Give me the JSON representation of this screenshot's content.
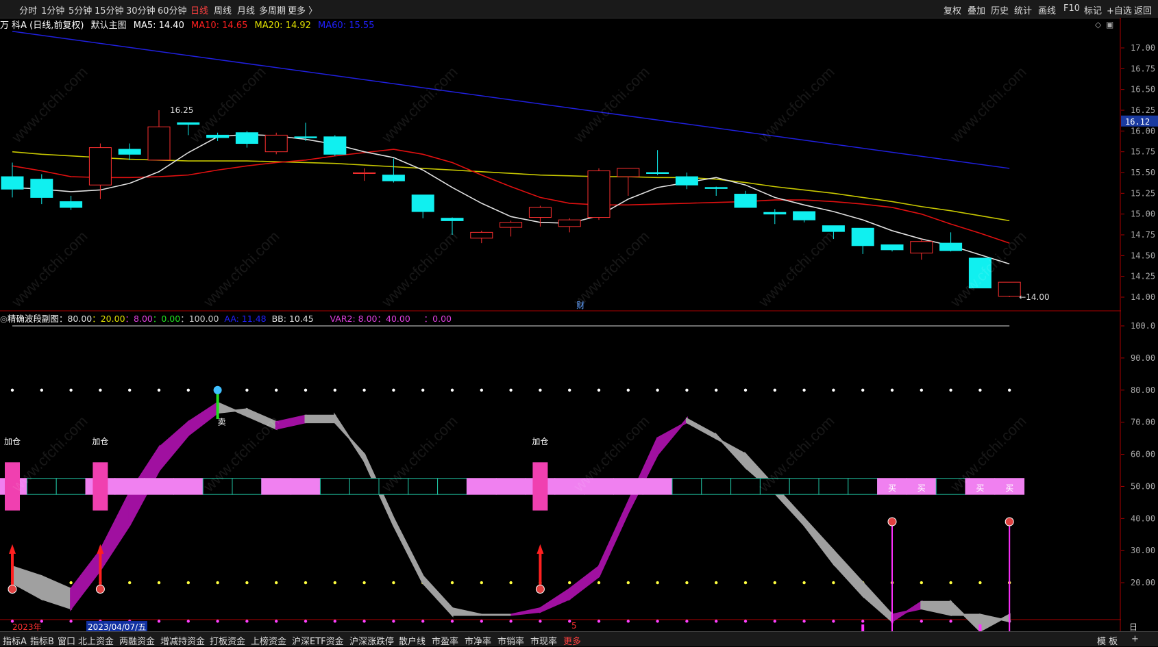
{
  "toolbar": {
    "left_items": [
      "分时",
      "1分钟",
      "5分钟",
      "15分钟",
      "30分钟",
      "60分钟",
      "日线",
      "周线",
      "月线",
      "多周期",
      "更多 〉"
    ],
    "active": "日线",
    "right_items": [
      "复权",
      "叠加",
      "历史",
      "统计",
      "画线",
      "F10",
      "标记",
      "+自选",
      "返回"
    ]
  },
  "main_chart": {
    "stock_name": "万 科A (日线,前复权)",
    "template_label": "默认主图",
    "ma5": "MA5: 14.40",
    "ma10": "MA10: 14.65",
    "ma20": "MA20: 14.92",
    "ma60": "MA60: 15.55",
    "ma_colors": {
      "ma5": "#ffffff",
      "ma10": "#ff2020",
      "ma20": "#e0e000",
      "ma60": "#2020ff"
    },
    "price_ticks": [
      "17.00",
      "16.75",
      "16.50",
      "16.25",
      "16.00",
      "15.75",
      "15.50",
      "15.25",
      "15.00",
      "14.75",
      "14.50",
      "14.25",
      "14.00"
    ],
    "current_price_tag": "16.12",
    "high_label": "16.25",
    "low_label": "←14.00",
    "finance_marker": "财",
    "candles": [
      {
        "o": 15.45,
        "c": 15.3,
        "h": 15.62,
        "l": 15.2
      },
      {
        "o": 15.42,
        "c": 15.2,
        "h": 15.48,
        "l": 15.12
      },
      {
        "o": 15.15,
        "c": 15.08,
        "h": 15.22,
        "l": 15.05
      },
      {
        "o": 15.35,
        "c": 15.8,
        "h": 15.85,
        "l": 15.18
      },
      {
        "o": 15.78,
        "c": 15.72,
        "h": 15.85,
        "l": 15.65
      },
      {
        "o": 15.65,
        "c": 16.05,
        "h": 16.25,
        "l": 15.65
      },
      {
        "o": 16.1,
        "c": 16.08,
        "h": 16.1,
        "l": 15.95
      },
      {
        "o": 15.95,
        "c": 15.92,
        "h": 15.98,
        "l": 15.88
      },
      {
        "o": 15.98,
        "c": 15.85,
        "h": 16.0,
        "l": 15.8
      },
      {
        "o": 15.75,
        "c": 15.95,
        "h": 15.98,
        "l": 15.72
      },
      {
        "o": 15.93,
        "c": 15.92,
        "h": 16.1,
        "l": 15.88
      },
      {
        "o": 15.93,
        "c": 15.72,
        "h": 15.95,
        "l": 15.7
      },
      {
        "o": 15.5,
        "c": 15.5,
        "h": 15.55,
        "l": 15.4
      },
      {
        "o": 15.47,
        "c": 15.4,
        "h": 15.67,
        "l": 15.38
      },
      {
        "o": 15.23,
        "c": 15.03,
        "h": 15.23,
        "l": 14.95
      },
      {
        "o": 14.95,
        "c": 14.92,
        "h": 14.96,
        "l": 14.75
      },
      {
        "o": 14.71,
        "c": 14.78,
        "h": 14.8,
        "l": 14.65
      },
      {
        "o": 14.84,
        "c": 14.9,
        "h": 14.92,
        "l": 14.73
      },
      {
        "o": 14.96,
        "c": 15.08,
        "h": 15.1,
        "l": 14.85
      },
      {
        "o": 14.85,
        "c": 14.93,
        "h": 14.95,
        "l": 14.78
      },
      {
        "o": 14.96,
        "c": 15.52,
        "h": 15.55,
        "l": 14.93
      },
      {
        "o": 15.45,
        "c": 15.55,
        "h": 15.55,
        "l": 15.22
      },
      {
        "o": 15.5,
        "c": 15.49,
        "h": 15.77,
        "l": 15.47
      },
      {
        "o": 15.45,
        "c": 15.35,
        "h": 15.5,
        "l": 15.3
      },
      {
        "o": 15.32,
        "c": 15.31,
        "h": 15.33,
        "l": 15.22
      },
      {
        "o": 15.24,
        "c": 15.08,
        "h": 15.28,
        "l": 15.08
      },
      {
        "o": 15.02,
        "c": 15.0,
        "h": 15.06,
        "l": 14.88
      },
      {
        "o": 15.03,
        "c": 14.93,
        "h": 15.03,
        "l": 14.9
      },
      {
        "o": 14.86,
        "c": 14.79,
        "h": 14.86,
        "l": 14.7
      },
      {
        "o": 14.83,
        "c": 14.62,
        "h": 14.83,
        "l": 14.52
      },
      {
        "o": 14.63,
        "c": 14.57,
        "h": 14.63,
        "l": 14.55
      },
      {
        "o": 14.53,
        "c": 14.67,
        "h": 14.7,
        "l": 14.45
      },
      {
        "o": 14.65,
        "c": 14.56,
        "h": 14.78,
        "l": 14.55
      },
      {
        "o": 14.47,
        "c": 14.11,
        "h": 14.47,
        "l": 14.11
      },
      {
        "o": 14.01,
        "c": 14.18,
        "h": 14.18,
        "l": 14.0
      }
    ],
    "ma5_series": [
      15.32,
      15.3,
      15.27,
      15.29,
      15.37,
      15.51,
      15.74,
      15.93,
      15.96,
      15.94,
      15.9,
      15.84,
      15.75,
      15.68,
      15.53,
      15.32,
      15.13,
      14.97,
      14.9,
      14.89,
      14.98,
      15.18,
      15.32,
      15.38,
      15.44,
      15.35,
      15.2,
      15.11,
      15.03,
      14.93,
      14.8,
      14.7,
      14.62,
      14.51,
      14.4
    ],
    "ma10_series": [
      15.58,
      15.52,
      15.45,
      15.44,
      15.44,
      15.45,
      15.47,
      15.53,
      15.58,
      15.62,
      15.65,
      15.7,
      15.74,
      15.78,
      15.72,
      15.62,
      15.47,
      15.33,
      15.2,
      15.13,
      15.11,
      15.11,
      15.12,
      15.13,
      15.14,
      15.15,
      15.17,
      15.17,
      15.15,
      15.12,
      15.08,
      15.0,
      14.88,
      14.77,
      14.65
    ],
    "ma20_series": [
      15.75,
      15.72,
      15.7,
      15.68,
      15.66,
      15.65,
      15.64,
      15.64,
      15.64,
      15.63,
      15.62,
      15.61,
      15.59,
      15.57,
      15.55,
      15.53,
      15.51,
      15.49,
      15.47,
      15.46,
      15.45,
      15.45,
      15.44,
      15.44,
      15.42,
      15.38,
      15.33,
      15.29,
      15.25,
      15.2,
      15.15,
      15.09,
      15.04,
      14.98,
      14.92
    ],
    "ma60_start": 17.2,
    "ma60_end": 15.55
  },
  "sub_chart": {
    "title": "精确波段副图",
    "params": [
      {
        "text": "：80.00",
        "color": "#e0e0e0"
      },
      {
        "text": "：20.00",
        "color": "#e0e000"
      },
      {
        "text": "：8.00",
        "color": "#e040e0"
      },
      {
        "text": "：0.00",
        "color": "#20e020"
      },
      {
        "text": "：100.00",
        "color": "#cccccc"
      },
      {
        "text": "  AA: 11.48",
        "color": "#2020ff"
      },
      {
        "text": "  BB: 10.45",
        "color": "#e0e0e0"
      },
      {
        "text": "      VAR2: 8.00",
        "color": "#e040e0"
      },
      {
        "text": "：40.00",
        "color": "#e040e0"
      },
      {
        "text": "     ：0.00",
        "color": "#e040e0"
      }
    ],
    "ticks": [
      "100.0",
      "90.00",
      "80.00",
      "70.00",
      "60.00",
      "50.00",
      "40.00",
      "30.00",
      "20.00"
    ],
    "add_label": "加仓",
    "sell_label": "卖",
    "buy_label": "买",
    "aa_series": [
      25,
      22,
      18,
      30,
      48,
      62,
      70,
      76,
      72,
      68,
      70,
      70,
      60,
      40,
      22,
      12,
      10,
      10,
      12,
      18,
      25,
      45,
      65,
      70,
      65,
      60,
      50,
      40,
      30,
      20,
      10,
      12,
      10,
      10,
      8
    ],
    "bb_series": [
      20,
      15,
      12,
      24,
      38,
      55,
      66,
      73,
      74,
      70,
      72,
      72,
      58,
      38,
      20,
      10,
      10,
      10,
      11,
      15,
      22,
      42,
      60,
      71,
      66,
      56,
      48,
      38,
      26,
      16,
      8,
      14,
      14,
      5,
      10
    ],
    "band_states": [
      2,
      0,
      0,
      2,
      2,
      2,
      2,
      0,
      0,
      2,
      2,
      0,
      0,
      0,
      0,
      0,
      2,
      2,
      2,
      2,
      2,
      2,
      2,
      0,
      0,
      0,
      0,
      0,
      0,
      0,
      3,
      3,
      0,
      3,
      3
    ],
    "add_positions": [
      0,
      3,
      18
    ],
    "buy_arrows": [
      0,
      3,
      18
    ],
    "sell_arrow": 7
  },
  "date_bar": {
    "year_label": "2023年",
    "selected_date": "2023/04/07/五",
    "mid_label": "5"
  },
  "right_axis_footer": "日线",
  "bottom_tabs": [
    "指标A",
    "指标B",
    "窗口",
    "北上资金",
    "两融资金",
    "增减持资金",
    "打板资金",
    "上榜资金",
    "沪深ETF资金",
    "沪深涨跌停",
    "散户线",
    "市盈率",
    "市净率",
    "市销率",
    "市现率",
    "更多"
  ],
  "bottom_right": [
    "模 板",
    "+"
  ],
  "watermark": "www.cfchi.com"
}
